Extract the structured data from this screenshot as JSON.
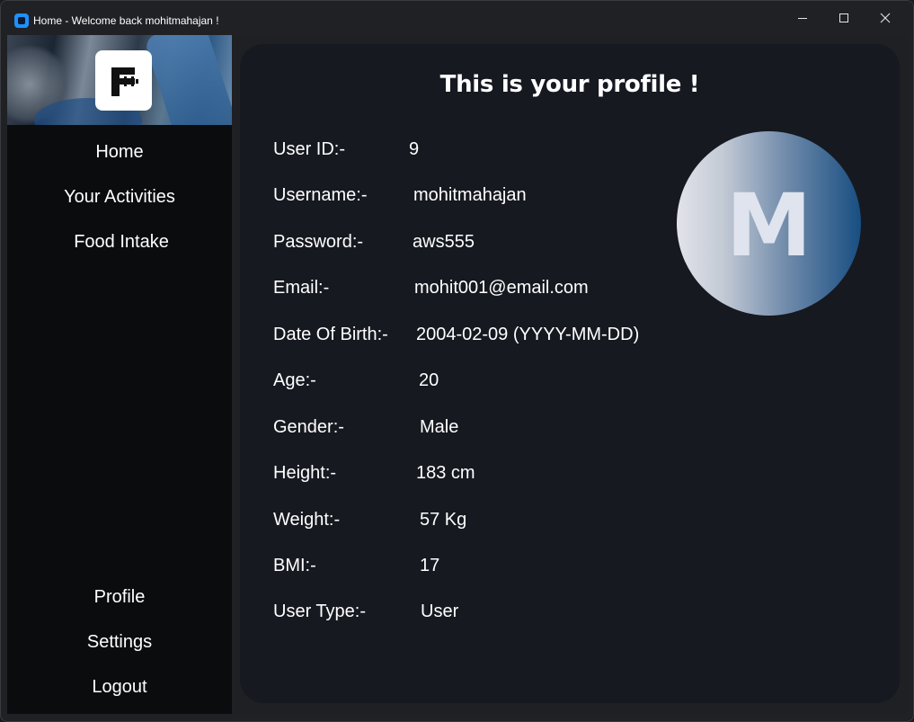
{
  "window": {
    "title": "Home - Welcome back mohitmahajan !"
  },
  "colors": {
    "accent": "#1e90ff",
    "sidebar_bg": "#0b0c0e",
    "panel_bg": "#161920",
    "text": "#ffffff",
    "avatar_gradient_end": "#184e82"
  },
  "sidebar": {
    "logo_icon": "dumbbell-f-logo-icon",
    "items_top": [
      {
        "label": "Home"
      },
      {
        "label": "Your Activities"
      },
      {
        "label": "Food Intake"
      }
    ],
    "items_bottom": [
      {
        "label": "Profile"
      },
      {
        "label": "Settings"
      },
      {
        "label": "Logout"
      }
    ]
  },
  "profile": {
    "title": "This is your profile !",
    "avatar_letter": "M",
    "fields": [
      {
        "label": "User ID:-",
        "value": "9"
      },
      {
        "label": "Username:-",
        "value": "mohitmahajan"
      },
      {
        "label": "Password:-",
        "value": "aws555"
      },
      {
        "label": "Email:-",
        "value": "mohit001@email.com"
      },
      {
        "label": "Date Of Birth:-",
        "value": "2004-02-09 (YYYY-MM-DD)"
      },
      {
        "label": "Age:-",
        "value": "20"
      },
      {
        "label": "Gender:-",
        "value": "Male"
      },
      {
        "label": "Height:-",
        "value": "183 cm"
      },
      {
        "label": "Weight:-",
        "value": "57 Kg"
      },
      {
        "label": "BMI:-",
        "value": "17"
      },
      {
        "label": "User Type:-",
        "value": "User"
      }
    ]
  }
}
